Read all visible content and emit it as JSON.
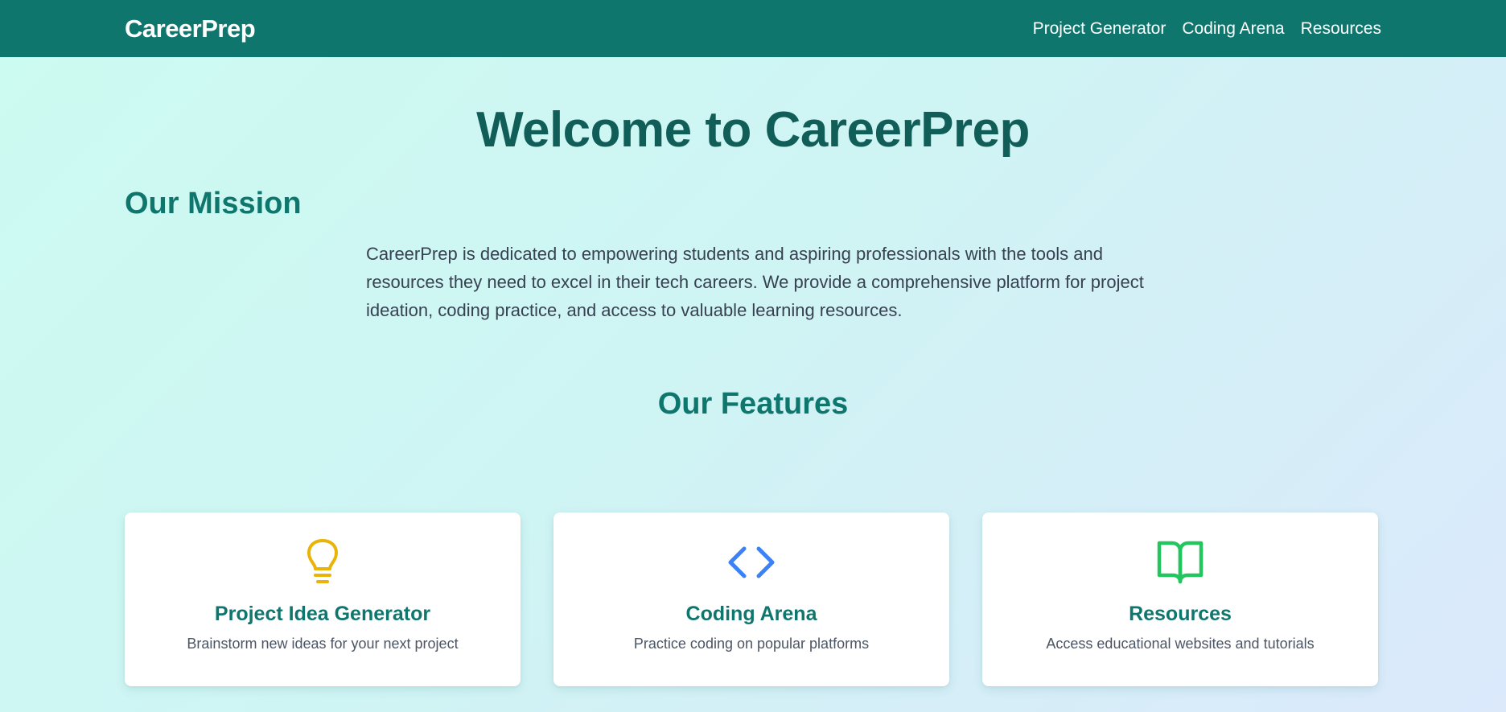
{
  "nav": {
    "brand": "CareerPrep",
    "links": [
      "Project Generator",
      "Coding Arena",
      "Resources"
    ]
  },
  "hero": {
    "title": "Welcome to CareerPrep"
  },
  "mission": {
    "heading": "Our Mission",
    "text": "CareerPrep is dedicated to empowering students and aspiring professionals with the tools and resources they need to excel in their tech careers. We provide a comprehensive platform for project ideation, coding practice, and access to valuable learning resources."
  },
  "features": {
    "heading": "Our Features",
    "cards": [
      {
        "icon": "lightbulb-icon",
        "title": "Project Idea Generator",
        "description": "Brainstorm new ideas for your next project"
      },
      {
        "icon": "code-icon",
        "title": "Coding Arena",
        "description": "Practice coding on popular platforms"
      },
      {
        "icon": "book-open-icon",
        "title": "Resources",
        "description": "Access educational websites and tutorials"
      }
    ]
  },
  "colors": {
    "nav_bg": "#0f766e",
    "heading": "#115e59",
    "lightbulb": "#eab308",
    "code": "#3b82f6",
    "book": "#22c55e"
  }
}
